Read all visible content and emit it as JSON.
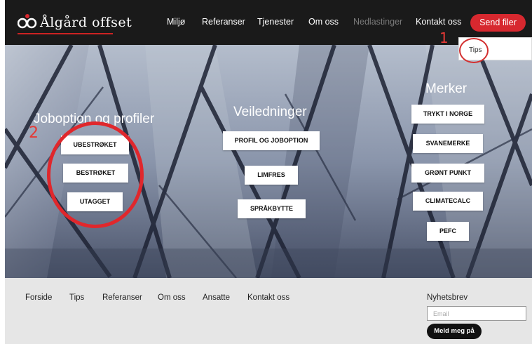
{
  "header": {
    "logo_text": "Ålgård offset",
    "nav": [
      {
        "label": "Miljø",
        "state": "normal"
      },
      {
        "label": "Referanser",
        "state": "normal"
      },
      {
        "label": "Tjenester",
        "state": "normal"
      },
      {
        "label": "Om oss",
        "state": "normal"
      },
      {
        "label": "Nedlastinger",
        "state": "dim"
      },
      {
        "label": "Kontakt oss",
        "state": "normal"
      }
    ],
    "send_button": "Send filer",
    "dropdown": {
      "items": [
        "Tips"
      ]
    }
  },
  "annotations": {
    "marker_1": "1",
    "marker_2": "2"
  },
  "hero": {
    "sections": [
      {
        "title": "Joboption og profiler",
        "buttons": [
          "UBESTRØKET",
          "BESTRØKET",
          "UTAGGET"
        ]
      },
      {
        "title": "Veiledninger",
        "buttons": [
          "PROFIL OG JOBOPTION",
          "LIMFRES",
          "SPRÅKBYTTE"
        ]
      },
      {
        "title": "Merker",
        "buttons": [
          "TRYKT I NORGE",
          "SVANEMERKE",
          "GRØNT PUNKT",
          "CLIMATECALC",
          "PEFC"
        ]
      }
    ]
  },
  "footer": {
    "links": [
      "Forside",
      "Tips",
      "Referanser",
      "Om oss",
      "Ansatte",
      "Kontakt oss"
    ],
    "newsletter": {
      "label": "Nyhetsbrev",
      "email_placeholder": "Email",
      "button": "Meld meg på"
    }
  },
  "colors": {
    "accent": "#d7282f",
    "header_bg": "#1a1a1a",
    "footer_bg": "#e6e6e6",
    "annotation": "#e53935"
  }
}
